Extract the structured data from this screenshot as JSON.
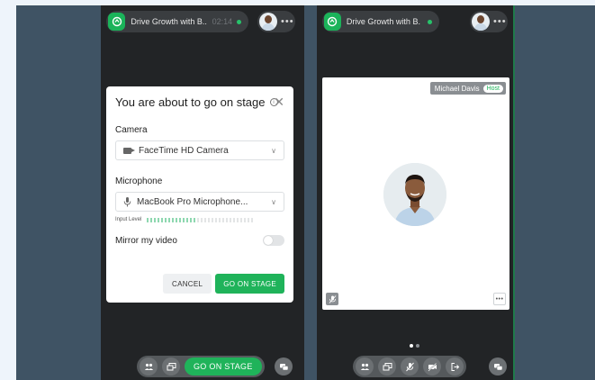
{
  "left_phone": {
    "session": {
      "title": "Drive Growth with B...",
      "timer": "02:14"
    },
    "dialog": {
      "title": "You are about to go on stage",
      "camera_label": "Camera",
      "camera_value": "FaceTime HD Camera",
      "microphone_label": "Microphone",
      "microphone_value": "MacBook Pro Microphone...",
      "input_level_label": "Input Level",
      "input_level_fraction": 0.45,
      "mirror_label": "Mirror my video",
      "mirror_on": false,
      "cancel_label": "CANCEL",
      "go_label": "GO ON STAGE"
    },
    "toolbar": {
      "go_label": "GO ON STAGE",
      "icons": [
        "people-icon",
        "screen-share-icon"
      ]
    }
  },
  "right_phone": {
    "session": {
      "title": "Drive Growth with B..."
    },
    "tile": {
      "name": "Michael Davis",
      "badge": "Host"
    },
    "toolbar": {
      "icons": [
        "people-icon",
        "screen-share-icon",
        "mic-off-icon",
        "camera-off-icon",
        "leave-icon"
      ]
    },
    "page_count": 2,
    "active_page": 1
  },
  "colors": {
    "brand_green": "#1fb35a",
    "stage_bg": "#3f5364",
    "phone_bg": "#222426"
  }
}
